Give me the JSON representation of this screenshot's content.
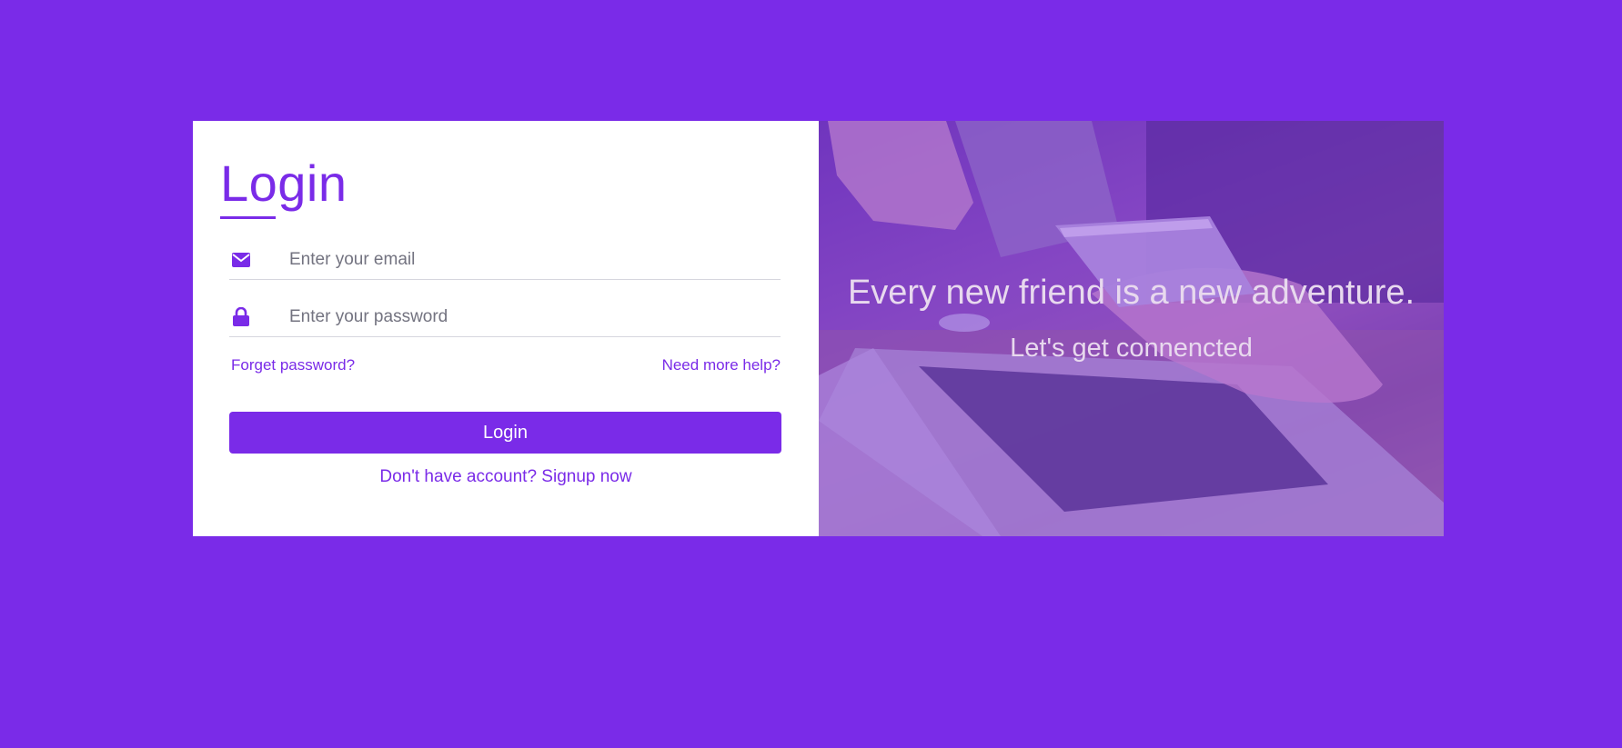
{
  "colors": {
    "background": "#7a2be8",
    "accent": "#7a2be8",
    "card": "#ffffff"
  },
  "form": {
    "title": "Login",
    "email": {
      "icon": "envelope-icon",
      "placeholder": "Enter your email",
      "value": ""
    },
    "password": {
      "icon": "lock-icon",
      "placeholder": "Enter your password",
      "value": ""
    },
    "forgot_password_label": "Forget password?",
    "help_label": "Need more help?",
    "submit_label": "Login",
    "signup_label": "Don't have account? Signup now"
  },
  "hero": {
    "quote": "Every new friend is a new adventure.",
    "sub_quote": "Let's get connencted"
  }
}
